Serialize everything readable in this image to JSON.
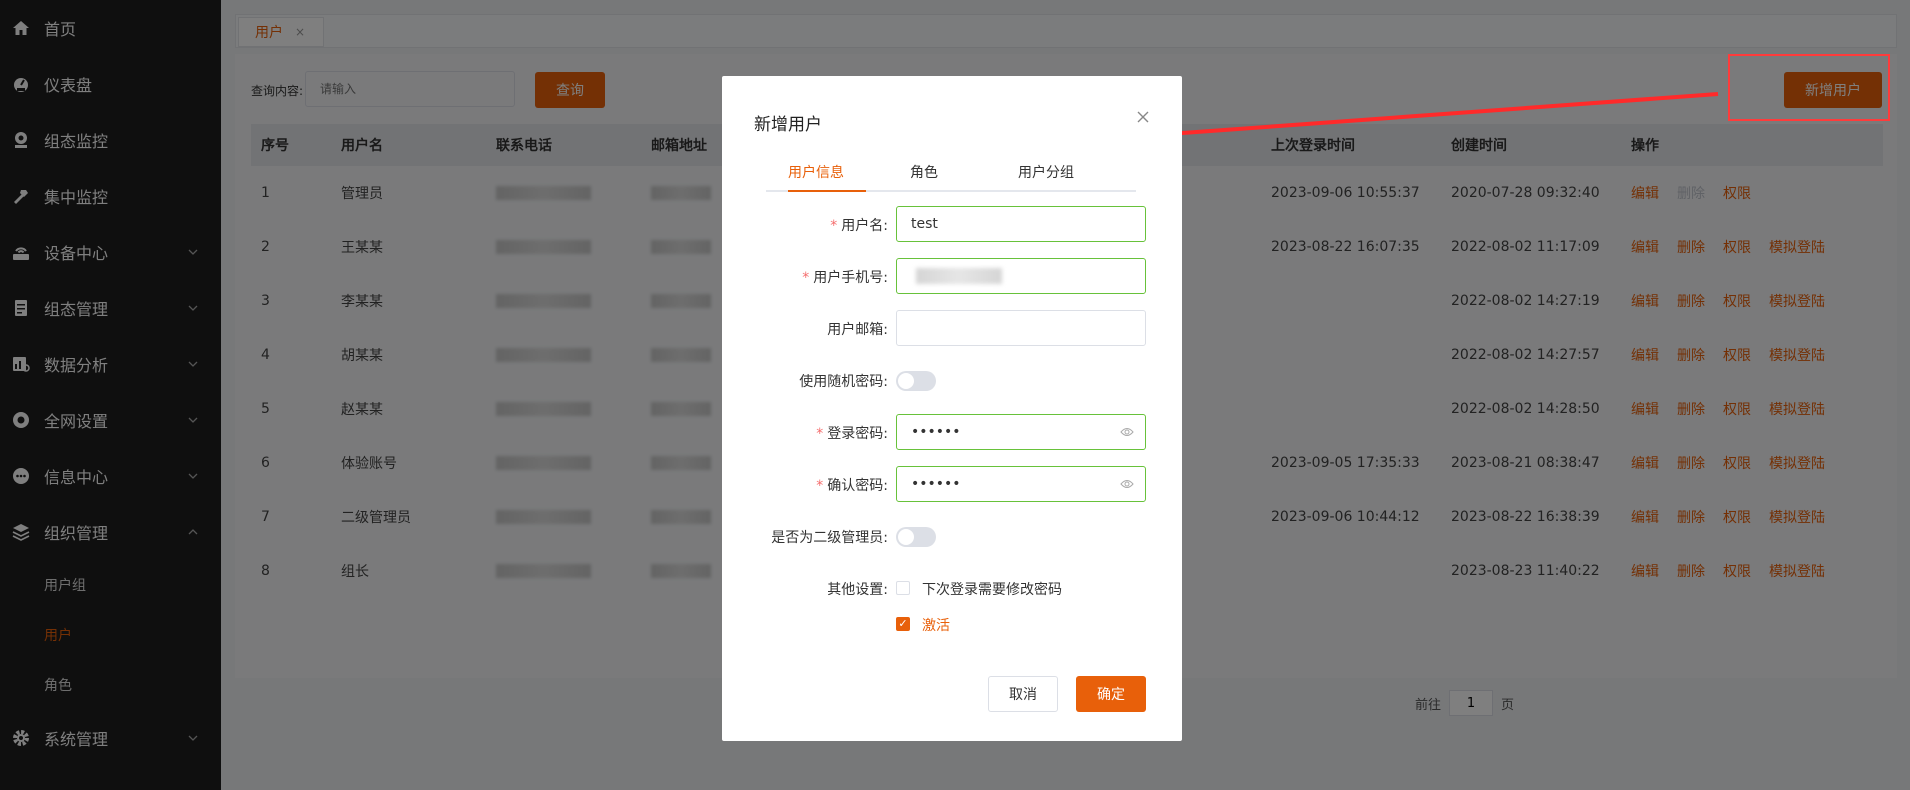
{
  "sidebar": {
    "items": [
      {
        "label": "首页",
        "icon": "home-icon"
      },
      {
        "label": "仪表盘",
        "icon": "dashboard-icon"
      },
      {
        "label": "组态监控",
        "icon": "webcam-icon"
      },
      {
        "label": "集中监控",
        "icon": "hammer-icon"
      },
      {
        "label": "设备中心",
        "icon": "router-icon"
      },
      {
        "label": "组态管理",
        "icon": "document-icon"
      },
      {
        "label": "数据分析",
        "icon": "data-analysis-icon"
      },
      {
        "label": "全网设置",
        "icon": "settings-circle-icon"
      },
      {
        "label": "信息中心",
        "icon": "chat-icon"
      },
      {
        "label": "组织管理",
        "icon": "layers-icon"
      },
      {
        "label": "系统管理",
        "icon": "gear-icon"
      }
    ],
    "subitems": [
      {
        "label": "用户组"
      },
      {
        "label": "用户",
        "active": true
      },
      {
        "label": "角色"
      }
    ]
  },
  "tab": {
    "label": "用户",
    "close": "×"
  },
  "search": {
    "label": "查询内容:",
    "placeholder": "请输入",
    "button": "查询"
  },
  "add_button": "新增用户",
  "table": {
    "headers": [
      "序号",
      "用户名",
      "联系电话",
      "邮箱地址",
      "上次登录时间",
      "创建时间",
      "操作"
    ],
    "rows": [
      {
        "no": "1",
        "name": "管理员",
        "last_login": "2023-09-06 10:55:37",
        "created": "2020-07-28 09:32:40",
        "ops": [
          "编辑",
          "删除",
          "权限"
        ],
        "delete_disabled": true
      },
      {
        "no": "2",
        "name": "王某某",
        "last_login": "2023-08-22 16:07:35",
        "created": "2022-08-02 11:17:09",
        "ops": [
          "编辑",
          "删除",
          "权限",
          "模拟登陆"
        ]
      },
      {
        "no": "3",
        "name": "李某某",
        "last_login": "",
        "created": "2022-08-02 14:27:19",
        "ops": [
          "编辑",
          "删除",
          "权限",
          "模拟登陆"
        ]
      },
      {
        "no": "4",
        "name": "胡某某",
        "last_login": "",
        "created": "2022-08-02 14:27:57",
        "ops": [
          "编辑",
          "删除",
          "权限",
          "模拟登陆"
        ]
      },
      {
        "no": "5",
        "name": "赵某某",
        "last_login": "",
        "created": "2022-08-02 14:28:50",
        "ops": [
          "编辑",
          "删除",
          "权限",
          "模拟登陆"
        ]
      },
      {
        "no": "6",
        "name": "体验账号",
        "last_login": "2023-09-05 17:35:33",
        "created": "2023-08-21 08:38:47",
        "ops": [
          "编辑",
          "删除",
          "权限",
          "模拟登陆"
        ]
      },
      {
        "no": "7",
        "name": "二级管理员",
        "last_login": "2023-09-06 10:44:12",
        "created": "2023-08-22 16:38:39",
        "ops": [
          "编辑",
          "删除",
          "权限",
          "模拟登陆"
        ]
      },
      {
        "no": "8",
        "name": "组长",
        "last_login": "",
        "created": "2023-08-23 11:40:22",
        "ops": [
          "编辑",
          "删除",
          "权限",
          "模拟登陆"
        ]
      }
    ]
  },
  "pager": {
    "goto": "前往",
    "page": "1",
    "unit": "页"
  },
  "modal": {
    "title": "新增用户",
    "tabs": [
      "用户信息",
      "角色",
      "用户分组"
    ],
    "fields": {
      "username": {
        "label": "用户名:",
        "value": "test",
        "required": true
      },
      "phone": {
        "label": "用户手机号:",
        "required": true
      },
      "email": {
        "label": "用户邮箱:",
        "value": ""
      },
      "random_pwd": {
        "label": "使用随机密码:"
      },
      "password": {
        "label": "登录密码:",
        "value": "••••••",
        "required": true
      },
      "confirm": {
        "label": "确认密码:",
        "value": "••••••",
        "required": true
      },
      "sub_admin": {
        "label": "是否为二级管理员:"
      },
      "other": {
        "label": "其他设置:",
        "opt1": "下次登录需要修改密码",
        "opt2": "激活"
      }
    },
    "cancel": "取消",
    "ok": "确定"
  },
  "colors": {
    "accent": "#e8600a",
    "sidebar": "#1f1f1f",
    "annotation": "#ff2a2a"
  }
}
